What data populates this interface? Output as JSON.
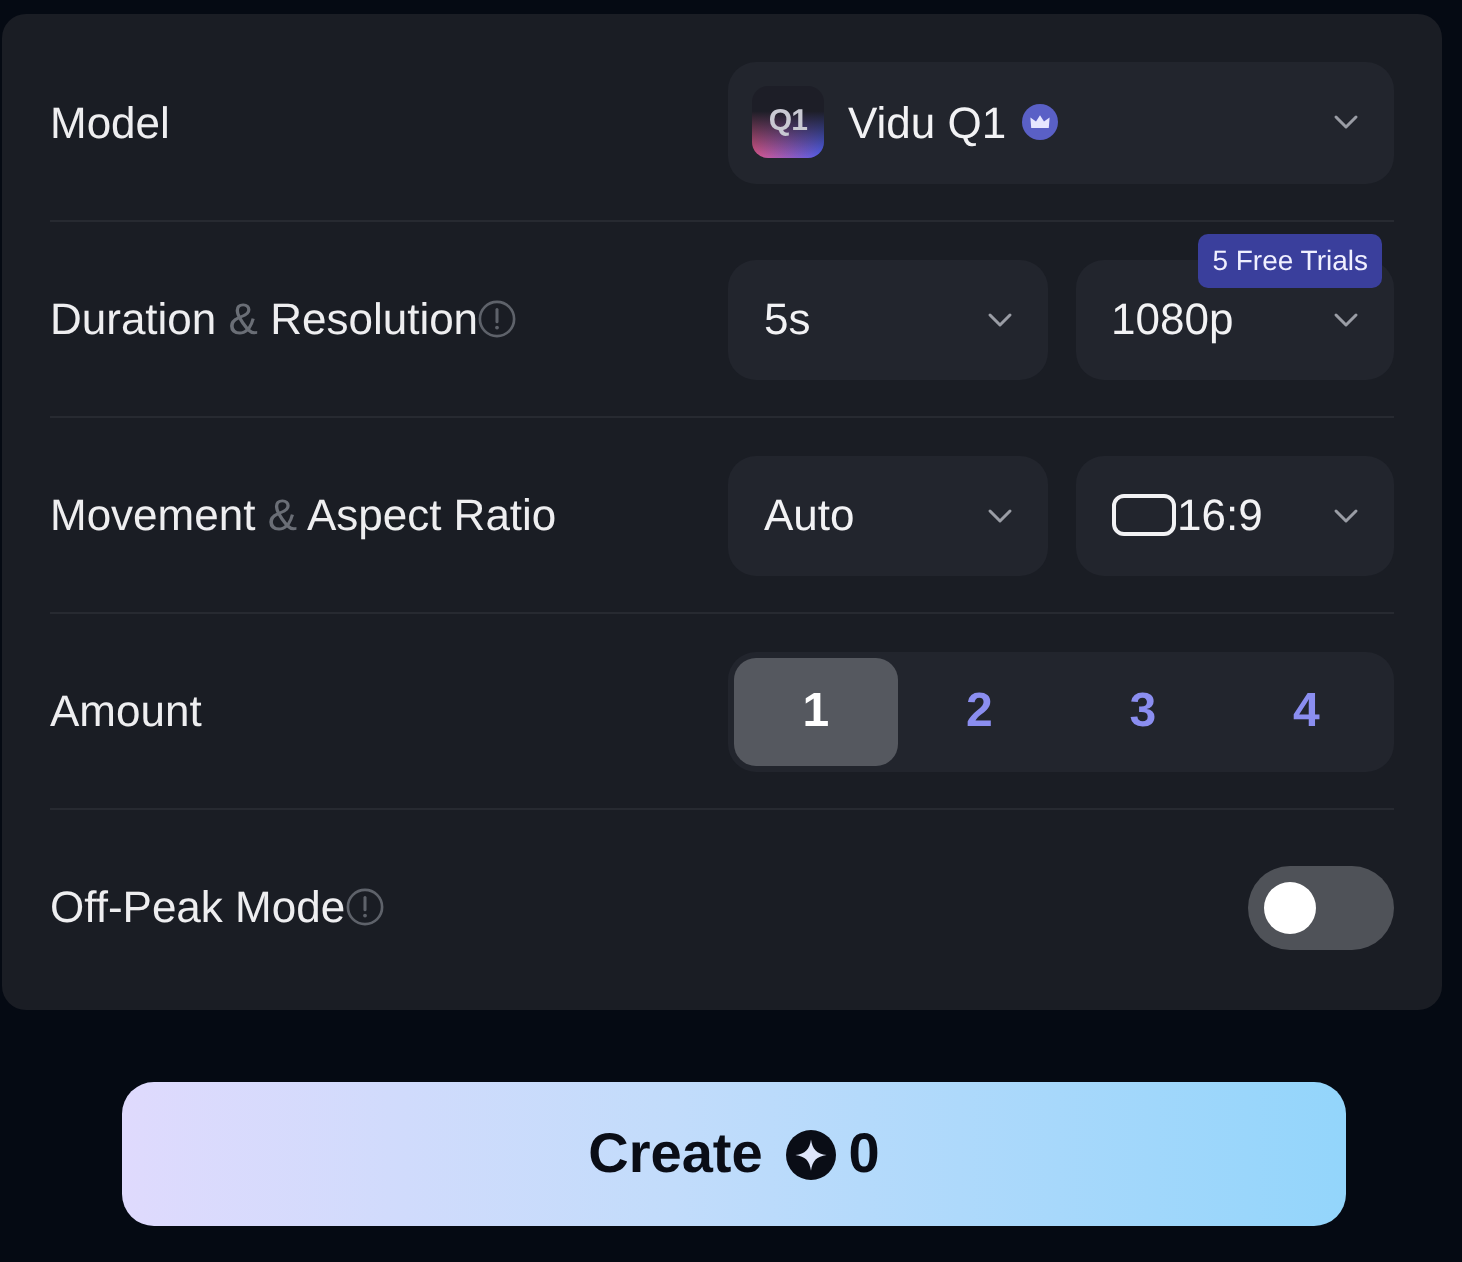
{
  "settings": [
    {
      "kind": "model",
      "label": "Model",
      "info": false,
      "control": {
        "logo_text": "Q1",
        "value": "Vidu Q1"
      }
    },
    {
      "kind": "pair",
      "label": "Duration",
      "connector": "&",
      "label_2": "Resolution",
      "info": true,
      "controls": [
        {
          "kind": "plain",
          "value": "5s"
        },
        {
          "kind": "plain",
          "value": "1080p",
          "badge": "5 Free Trials"
        }
      ]
    },
    {
      "kind": "pair",
      "label": "Movement",
      "connector": "&",
      "label_2": "Aspect Ratio",
      "info": false,
      "controls": [
        {
          "kind": "plain",
          "value": "Auto"
        },
        {
          "kind": "ratio",
          "value": "16:9"
        }
      ]
    },
    {
      "kind": "segmented",
      "label": "Amount",
      "info": false,
      "options": [
        {
          "label": "1",
          "selected": true
        },
        {
          "label": "2",
          "selected": false
        },
        {
          "label": "3",
          "selected": false
        },
        {
          "label": "4",
          "selected": false
        }
      ]
    },
    {
      "kind": "toggle",
      "label": "Off-Peak Mode",
      "info": true,
      "on": false
    }
  ],
  "create_button": {
    "label": "Create",
    "credits": "0"
  }
}
